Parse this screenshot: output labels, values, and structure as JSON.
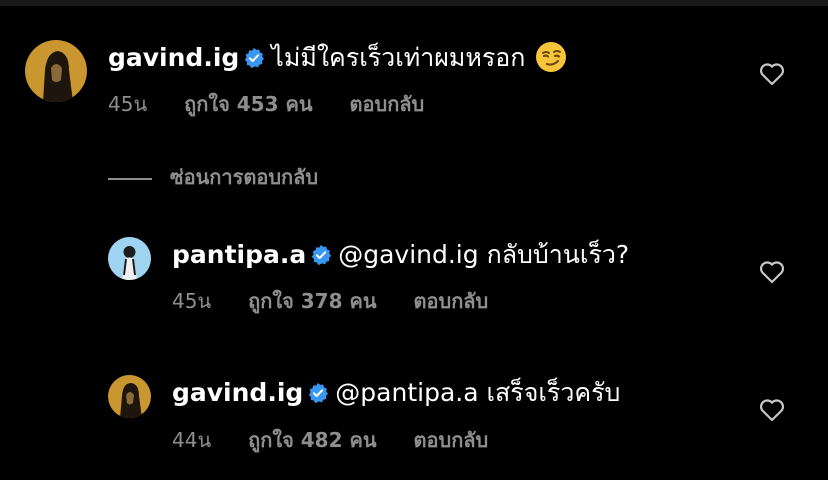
{
  "comments": [
    {
      "username": "gavind.ig",
      "text": "ไม่มีใครเร็วเท่าผมหรอก",
      "emoji": "smirking-face",
      "time": "45น",
      "likes": "ถูกใจ 453 คน",
      "reply": "ตอบกลับ"
    },
    {
      "username": "pantipa.a",
      "text": "@gavind.ig กลับบ้านเร็ว?",
      "time": "45น",
      "likes": "ถูกใจ 378 คน",
      "reply": "ตอบกลับ"
    },
    {
      "username": "gavind.ig",
      "text": "@pantipa.a เสร็จเร็วครับ",
      "time": "44น",
      "likes": "ถูกใจ 482 คน",
      "reply": "ตอบกลับ"
    }
  ],
  "hide_replies": "ซ่อนการตอบกลับ",
  "icons": {
    "verified": "verified-badge-icon",
    "like": "heart-icon"
  },
  "colors": {
    "background": "#000000",
    "secondary_text": "#8e8e8e",
    "verified": "#3897f0"
  }
}
